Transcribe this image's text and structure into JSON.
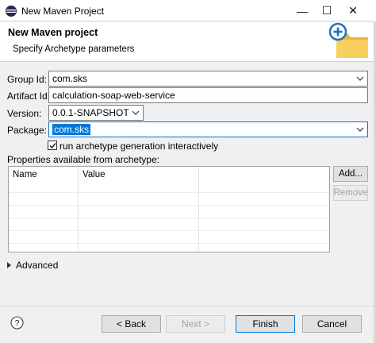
{
  "window": {
    "title": "New Maven Project",
    "min_glyph": "—",
    "max_glyph": "☐",
    "close_glyph": "✕"
  },
  "header": {
    "title": "New Maven project",
    "subtitle": "Specify Archetype parameters"
  },
  "form": {
    "group_id": {
      "label": "Group Id:",
      "value": "com.sks"
    },
    "artifact_id": {
      "label": "Artifact Id:",
      "value": "calculation-soap-web-service"
    },
    "version": {
      "label": "Version:",
      "value": "0.0.1-SNAPSHOT"
    },
    "package": {
      "label": "Package:",
      "value": "com.sks"
    },
    "interactive": {
      "label": "run archetype generation interactively",
      "checked": true
    }
  },
  "properties": {
    "label": "Properties available from archetype:",
    "columns": [
      "Name",
      "Value"
    ],
    "add_label": "Add...",
    "remove_label": "Remove"
  },
  "advanced_label": "Advanced",
  "footer": {
    "help_glyph": "?",
    "back_label": "< Back",
    "next_label": "Next >",
    "finish_label": "Finish",
    "cancel_label": "Cancel"
  },
  "colors": {
    "selection": "#0078d7",
    "folder": "#f5c94a",
    "plus_badge": "#1e73be"
  }
}
